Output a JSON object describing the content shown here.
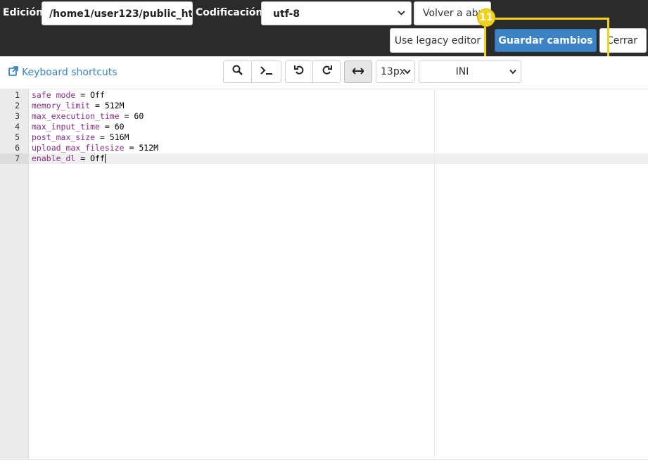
{
  "header": {
    "edit_label": "Edición:",
    "path_value": "/home1/user123/public_ht",
    "encoding_label": "Codificación:",
    "encoding_value": "utf-8",
    "reopen_label": "Volver a abr",
    "legacy_label": "Use legacy editor",
    "save_label": "Guardar cambios",
    "close_label": "Cerrar",
    "badge_number": "11"
  },
  "toolbar": {
    "shortcuts_label": "Keyboard shortcuts",
    "font_size": "13px",
    "mode": "INI"
  },
  "editor": {
    "lines": [
      {
        "num": "1",
        "key": "safe mode",
        "val": "Off"
      },
      {
        "num": "2",
        "key": "memory_limit",
        "val": "512M"
      },
      {
        "num": "3",
        "key": "max_execution_time",
        "val": "60"
      },
      {
        "num": "4",
        "key": "max_input_time",
        "val": "60"
      },
      {
        "num": "5",
        "key": "post_max_size",
        "val": "516M"
      },
      {
        "num": "6",
        "key": "upload_max_filesize",
        "val": "512M"
      },
      {
        "num": "7",
        "key": "enable_dl",
        "val": "Off"
      }
    ],
    "active_line": 7
  },
  "colors": {
    "primary": "#3c83c6",
    "highlight": "#f2d21b",
    "key": "#8a2c87"
  }
}
